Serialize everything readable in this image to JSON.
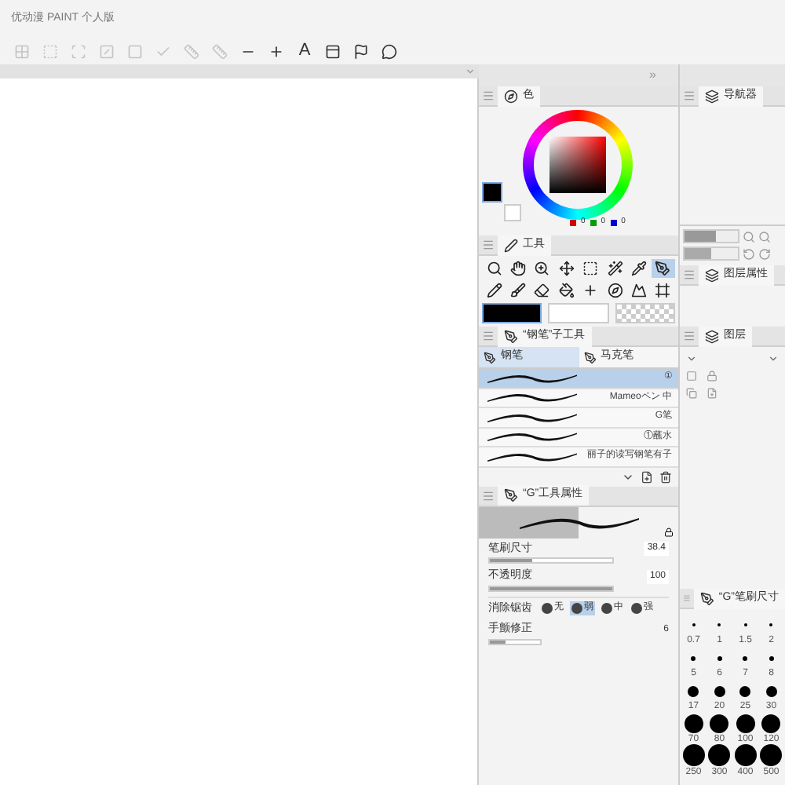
{
  "app_title": "优动漫 PAINT 个人版",
  "toolbar": [
    {
      "kind": "grid",
      "disabled": true
    },
    {
      "kind": "select",
      "disabled": true
    },
    {
      "kind": "scan",
      "disabled": true
    },
    {
      "kind": "gradient",
      "disabled": true
    },
    {
      "kind": "frame",
      "disabled": true
    },
    {
      "kind": "check",
      "disabled": true
    },
    {
      "kind": "ruler",
      "disabled": true
    },
    {
      "kind": "ruler",
      "disabled": true
    },
    {
      "kind": "line",
      "disabled": false
    },
    {
      "kind": "plus",
      "disabled": false
    },
    {
      "kind": "text",
      "label": "A",
      "disabled": false
    },
    {
      "kind": "panel",
      "disabled": false
    },
    {
      "kind": "flag",
      "disabled": false
    },
    {
      "kind": "balloon",
      "disabled": false
    }
  ],
  "collapse_mark": "»",
  "color_panel": {
    "tab_label": "色",
    "values": [
      "0",
      "0",
      "0"
    ]
  },
  "tool_panel": {
    "title": "工具",
    "tools": [
      {
        "kind": "zoom",
        "selected": false
      },
      {
        "kind": "hand",
        "selected": false
      },
      {
        "kind": "zoomin",
        "selected": false
      },
      {
        "kind": "move",
        "selected": false
      },
      {
        "kind": "select",
        "selected": false
      },
      {
        "kind": "wand",
        "selected": false
      },
      {
        "kind": "pipette",
        "selected": false
      },
      {
        "kind": "pen",
        "selected": true
      },
      {
        "kind": "pencil",
        "selected": false
      },
      {
        "kind": "brush",
        "selected": false
      },
      {
        "kind": "eraser",
        "selected": false
      },
      {
        "kind": "fill",
        "selected": false
      },
      {
        "kind": "plus",
        "selected": false
      },
      {
        "kind": "compass",
        "selected": false
      },
      {
        "kind": "mountain",
        "selected": false
      },
      {
        "kind": "frame",
        "selected": false
      }
    ]
  },
  "sub_tool": {
    "title": "“钢笔”子工具",
    "tabs": [
      {
        "label": "钢笔",
        "selected": true
      },
      {
        "label": "马克笔",
        "selected": false
      }
    ],
    "brushes": [
      {
        "name": "①",
        "selected": true
      },
      {
        "name": "Mameoペン 中",
        "selected": false
      },
      {
        "name": "G笔",
        "selected": false
      },
      {
        "name": "①蘸水",
        "selected": false
      },
      {
        "name": "丽子的读写钢笔有子",
        "selected": false
      }
    ]
  },
  "tool_property": {
    "title": "“G”工具属性",
    "sliders": [
      {
        "label": "笔刷尺寸",
        "value": "38.4",
        "level": 0.35
      },
      {
        "label": "不透明度",
        "value": "100",
        "level": 1
      }
    ],
    "antialias": {
      "label": "消除锯齿",
      "options": [
        {
          "label": "无",
          "selected": false
        },
        {
          "label": "弱",
          "selected": true
        },
        {
          "label": "中",
          "selected": false
        },
        {
          "label": "强",
          "selected": false
        }
      ]
    },
    "stabilization": {
      "label": "手颤修正",
      "value": "6",
      "level": 0.3
    }
  },
  "navigator": {
    "title": "导航器",
    "zoom": {
      "level": 0.6
    },
    "rotation": {
      "level": 0.5
    }
  },
  "layer_property": {
    "title": "图层属性"
  },
  "layer": {
    "title": "图层"
  },
  "brush_size": {
    "title": "“G”笔刷尺寸",
    "sizes": [
      "0.7",
      "1",
      "1.5",
      "2",
      "5",
      "6",
      "7",
      "8",
      "17",
      "20",
      "25",
      "30",
      "70",
      "80",
      "100",
      "120",
      "250",
      "300",
      "400",
      "500"
    ]
  }
}
